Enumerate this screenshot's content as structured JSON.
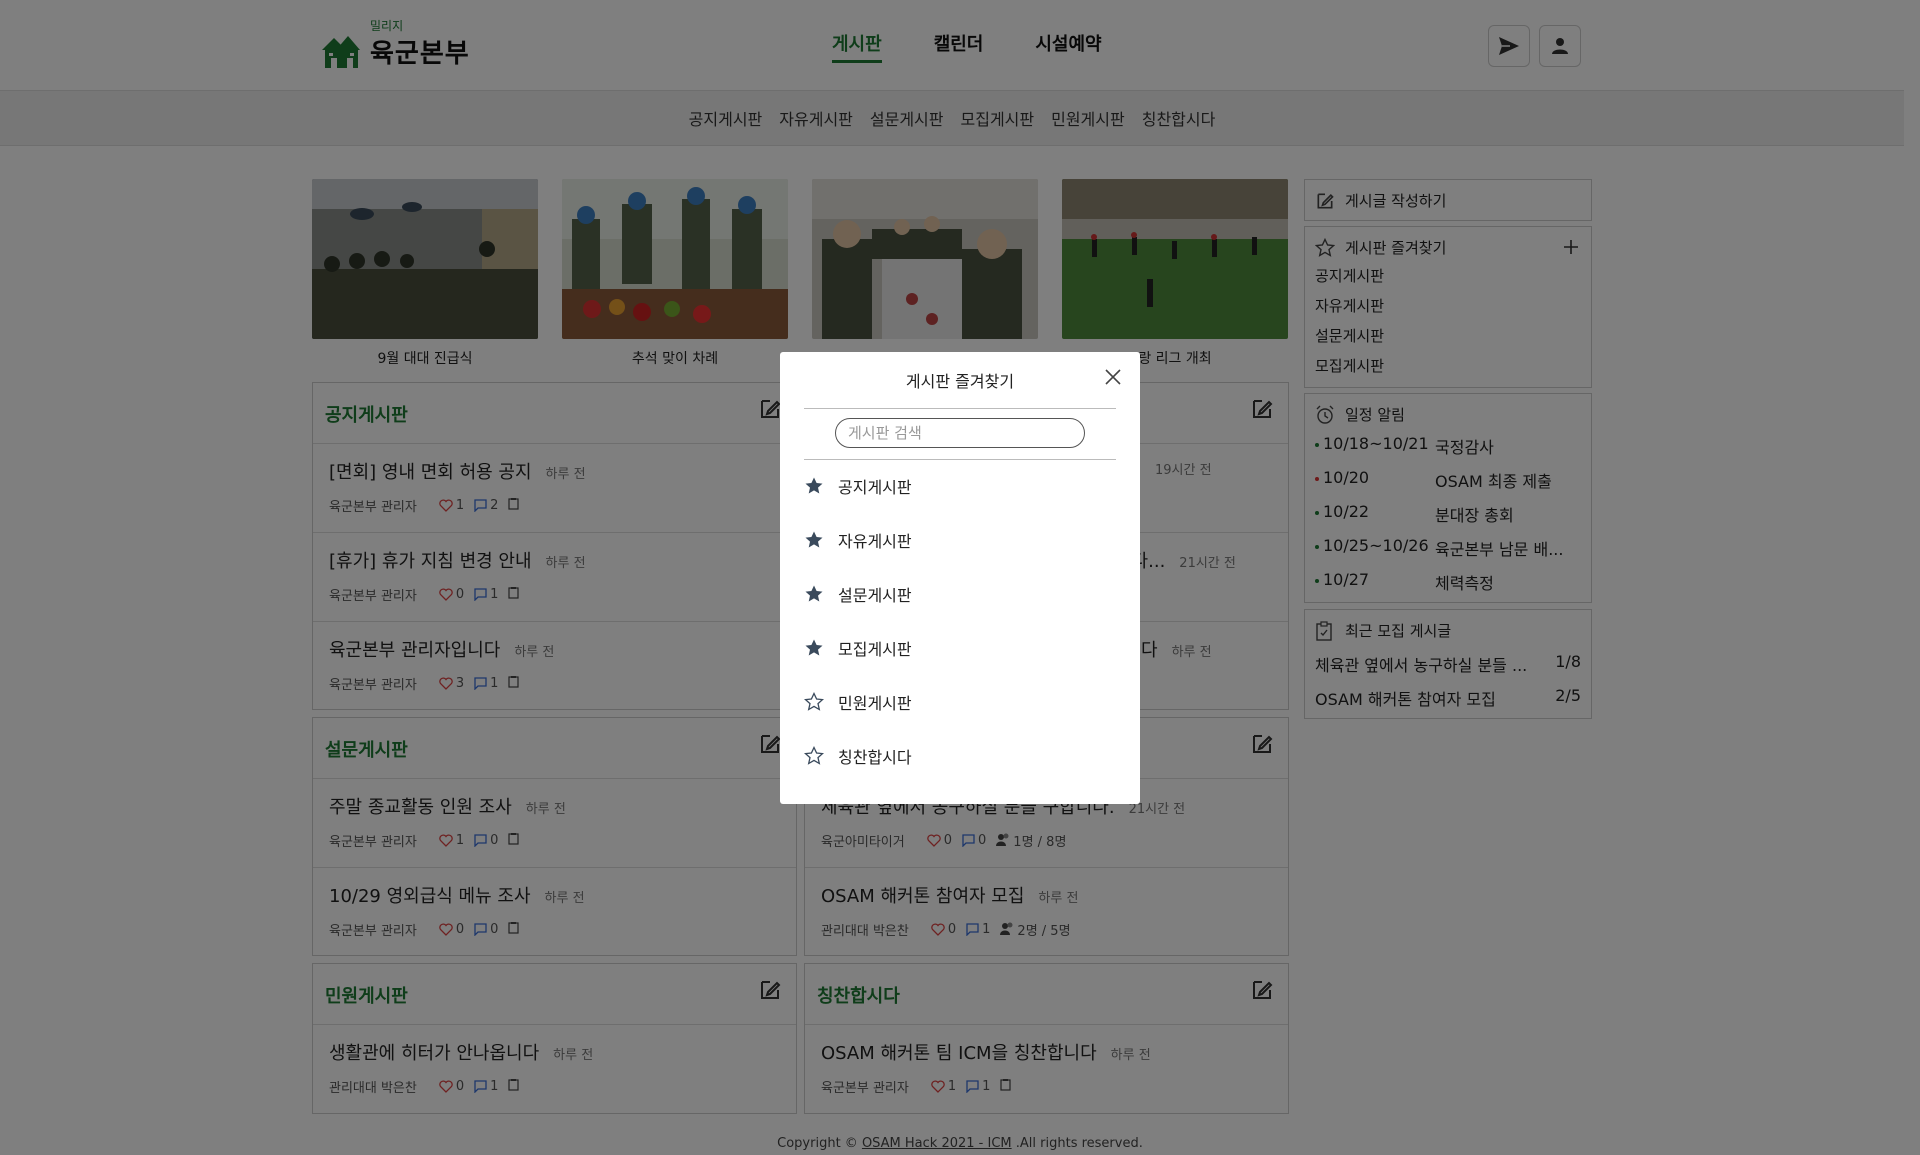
{
  "logo": {
    "small": "밀리지",
    "main": "육군본부"
  },
  "nav": {
    "items": [
      "게시판",
      "캘린더",
      "시설예약"
    ],
    "active": "게시판"
  },
  "subnav": [
    "공지게시판",
    "자유게시판",
    "설문게시판",
    "모집게시판",
    "민원게시판",
    "칭찬합시다"
  ],
  "photos": [
    {
      "caption": "9월 대대 진급식"
    },
    {
      "caption": "추석 맞이 차례"
    },
    {
      "caption": ""
    },
    {
      "caption": "랑 리그 개최"
    }
  ],
  "boards": {
    "notice": {
      "title": "공지게시판",
      "posts": [
        {
          "title": "[면회] 영내 면회 허용 공지",
          "time": "하루 전",
          "author": "육군본부 관리자",
          "likes": "1",
          "comments": "2"
        },
        {
          "title": "[휴가] 휴가 지침 변경 안내",
          "time": "하루 전",
          "author": "육군본부 관리자",
          "likes": "0",
          "comments": "1"
        },
        {
          "title": "육군본부 관리자입니다",
          "time": "하루 전",
          "author": "육군본부 관리자",
          "likes": "3",
          "comments": "1"
        }
      ]
    },
    "free": {
      "posts": [
        {
          "time": "19시간 전"
        },
        {
          "title": "니다...",
          "time": "21시간 전"
        },
        {
          "title": "다",
          "time": "하루 전"
        }
      ]
    },
    "survey": {
      "title": "설문게시판",
      "posts": [
        {
          "title": "주말 종교활동 인원 조사",
          "time": "하루 전",
          "author": "육군본부 관리자",
          "likes": "1",
          "comments": "0"
        },
        {
          "title": "10/29 영외급식 메뉴 조사",
          "time": "하루 전",
          "author": "육군본부 관리자",
          "likes": "0",
          "comments": "0"
        }
      ]
    },
    "recruit": {
      "posts": [
        {
          "title": "체육관 옆에서 농구하실 분들 구합니다.",
          "time": "21시간 전",
          "author": "육군아미타이거",
          "likes": "0",
          "comments": "0",
          "people": "1명 / 8명"
        },
        {
          "title": "OSAM 해커톤 참여자 모집",
          "time": "하루 전",
          "author": "관리대대 박은찬",
          "likes": "0",
          "comments": "1",
          "people": "2명 / 5명"
        }
      ]
    },
    "complaint": {
      "title": "민원게시판",
      "posts": [
        {
          "title": "생활관에 히터가 안나옵니다",
          "time": "하루 전",
          "author": "관리대대 박은찬",
          "likes": "0",
          "comments": "1"
        }
      ]
    },
    "praise": {
      "title": "칭찬합시다",
      "posts": [
        {
          "title": "OSAM 해커톤 팀 ICM을 칭찬합니다",
          "time": "하루 전",
          "author": "육군본부 관리자",
          "likes": "1",
          "comments": "1"
        }
      ]
    }
  },
  "sidebar": {
    "write": "게시글 작성하기",
    "favorites": {
      "title": "게시판 즐겨찾기",
      "items": [
        "공지게시판",
        "자유게시판",
        "설문게시판",
        "모집게시판"
      ]
    },
    "schedule": {
      "title": "일정 알림",
      "items": [
        {
          "date": "10/18~10/21",
          "text": "국정감사"
        },
        {
          "date": "10/20",
          "text": "OSAM 최종 제출"
        },
        {
          "date": "10/22",
          "text": "분대장 총회"
        },
        {
          "date": "10/25~10/26",
          "text": "육군본부 남문 배..."
        },
        {
          "date": "10/27",
          "text": "체력측정"
        }
      ]
    },
    "recruit": {
      "title": "최근 모집 게시글",
      "items": [
        {
          "title": "체육관 옆에서 농구하실 분들 ...",
          "count": "1/8"
        },
        {
          "title": "OSAM 해커톤 참여자 모집",
          "count": "2/5"
        }
      ]
    }
  },
  "footer": {
    "prefix": "Copyright ©",
    "link": "OSAM Hack 2021 - ICM",
    "suffix": ".All rights reserved."
  },
  "modal": {
    "title": "게시판 즐겨찾기",
    "search_placeholder": "게시판 검색",
    "items": [
      {
        "label": "공지게시판",
        "starred": true
      },
      {
        "label": "자유게시판",
        "starred": true
      },
      {
        "label": "설문게시판",
        "starred": true
      },
      {
        "label": "모집게시판",
        "starred": true
      },
      {
        "label": "민원게시판",
        "starred": false
      },
      {
        "label": "칭찬합시다",
        "starred": false
      }
    ]
  },
  "colors": {
    "brand": "#1e7a34",
    "like": "#d44",
    "comment": "#3a6fd8",
    "star": "#3a4a5c"
  },
  "icons": [
    "house-logo-icon",
    "send-icon",
    "user-icon",
    "edit-icon",
    "heart-icon",
    "comment-icon",
    "clipboard-icon",
    "people-icon",
    "star-icon",
    "plus-icon",
    "alarm-icon",
    "close-icon"
  ]
}
